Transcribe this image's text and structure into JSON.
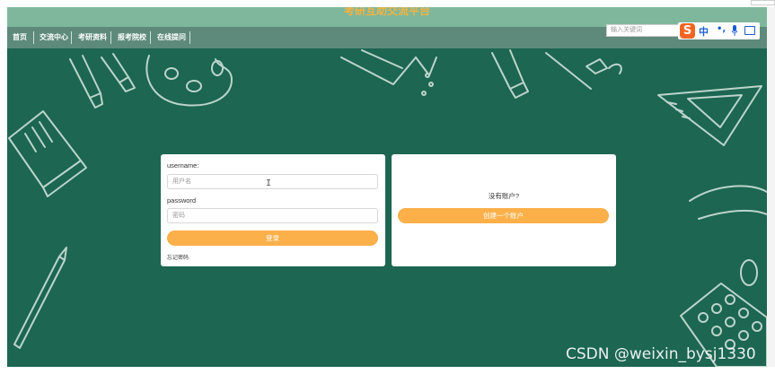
{
  "site": {
    "title": "考研互助交流平台"
  },
  "nav": {
    "items": [
      {
        "label": "首页"
      },
      {
        "label": "交流中心"
      },
      {
        "label": "考研资料"
      },
      {
        "label": "报考院校"
      },
      {
        "label": "在线提问"
      }
    ]
  },
  "search": {
    "placeholder": "输入关键词"
  },
  "ime": {
    "logo": "S",
    "mode": "中",
    "punct": "•,"
  },
  "login": {
    "username_label": "username:",
    "username_placeholder": "用户名",
    "password_label": "password",
    "password_placeholder": "密码",
    "submit_label": "登录",
    "forgot_label": "忘记密码"
  },
  "register": {
    "prompt": "没有账户?",
    "create_label": "创建一个账户"
  },
  "watermark": "CSDN @weixin_bysj1330",
  "colors": {
    "board": "#1c6652",
    "topbar": "#7fb79c",
    "navbar": "#5d8a7b",
    "accent": "#fbb04a",
    "title": "#f2b341"
  }
}
